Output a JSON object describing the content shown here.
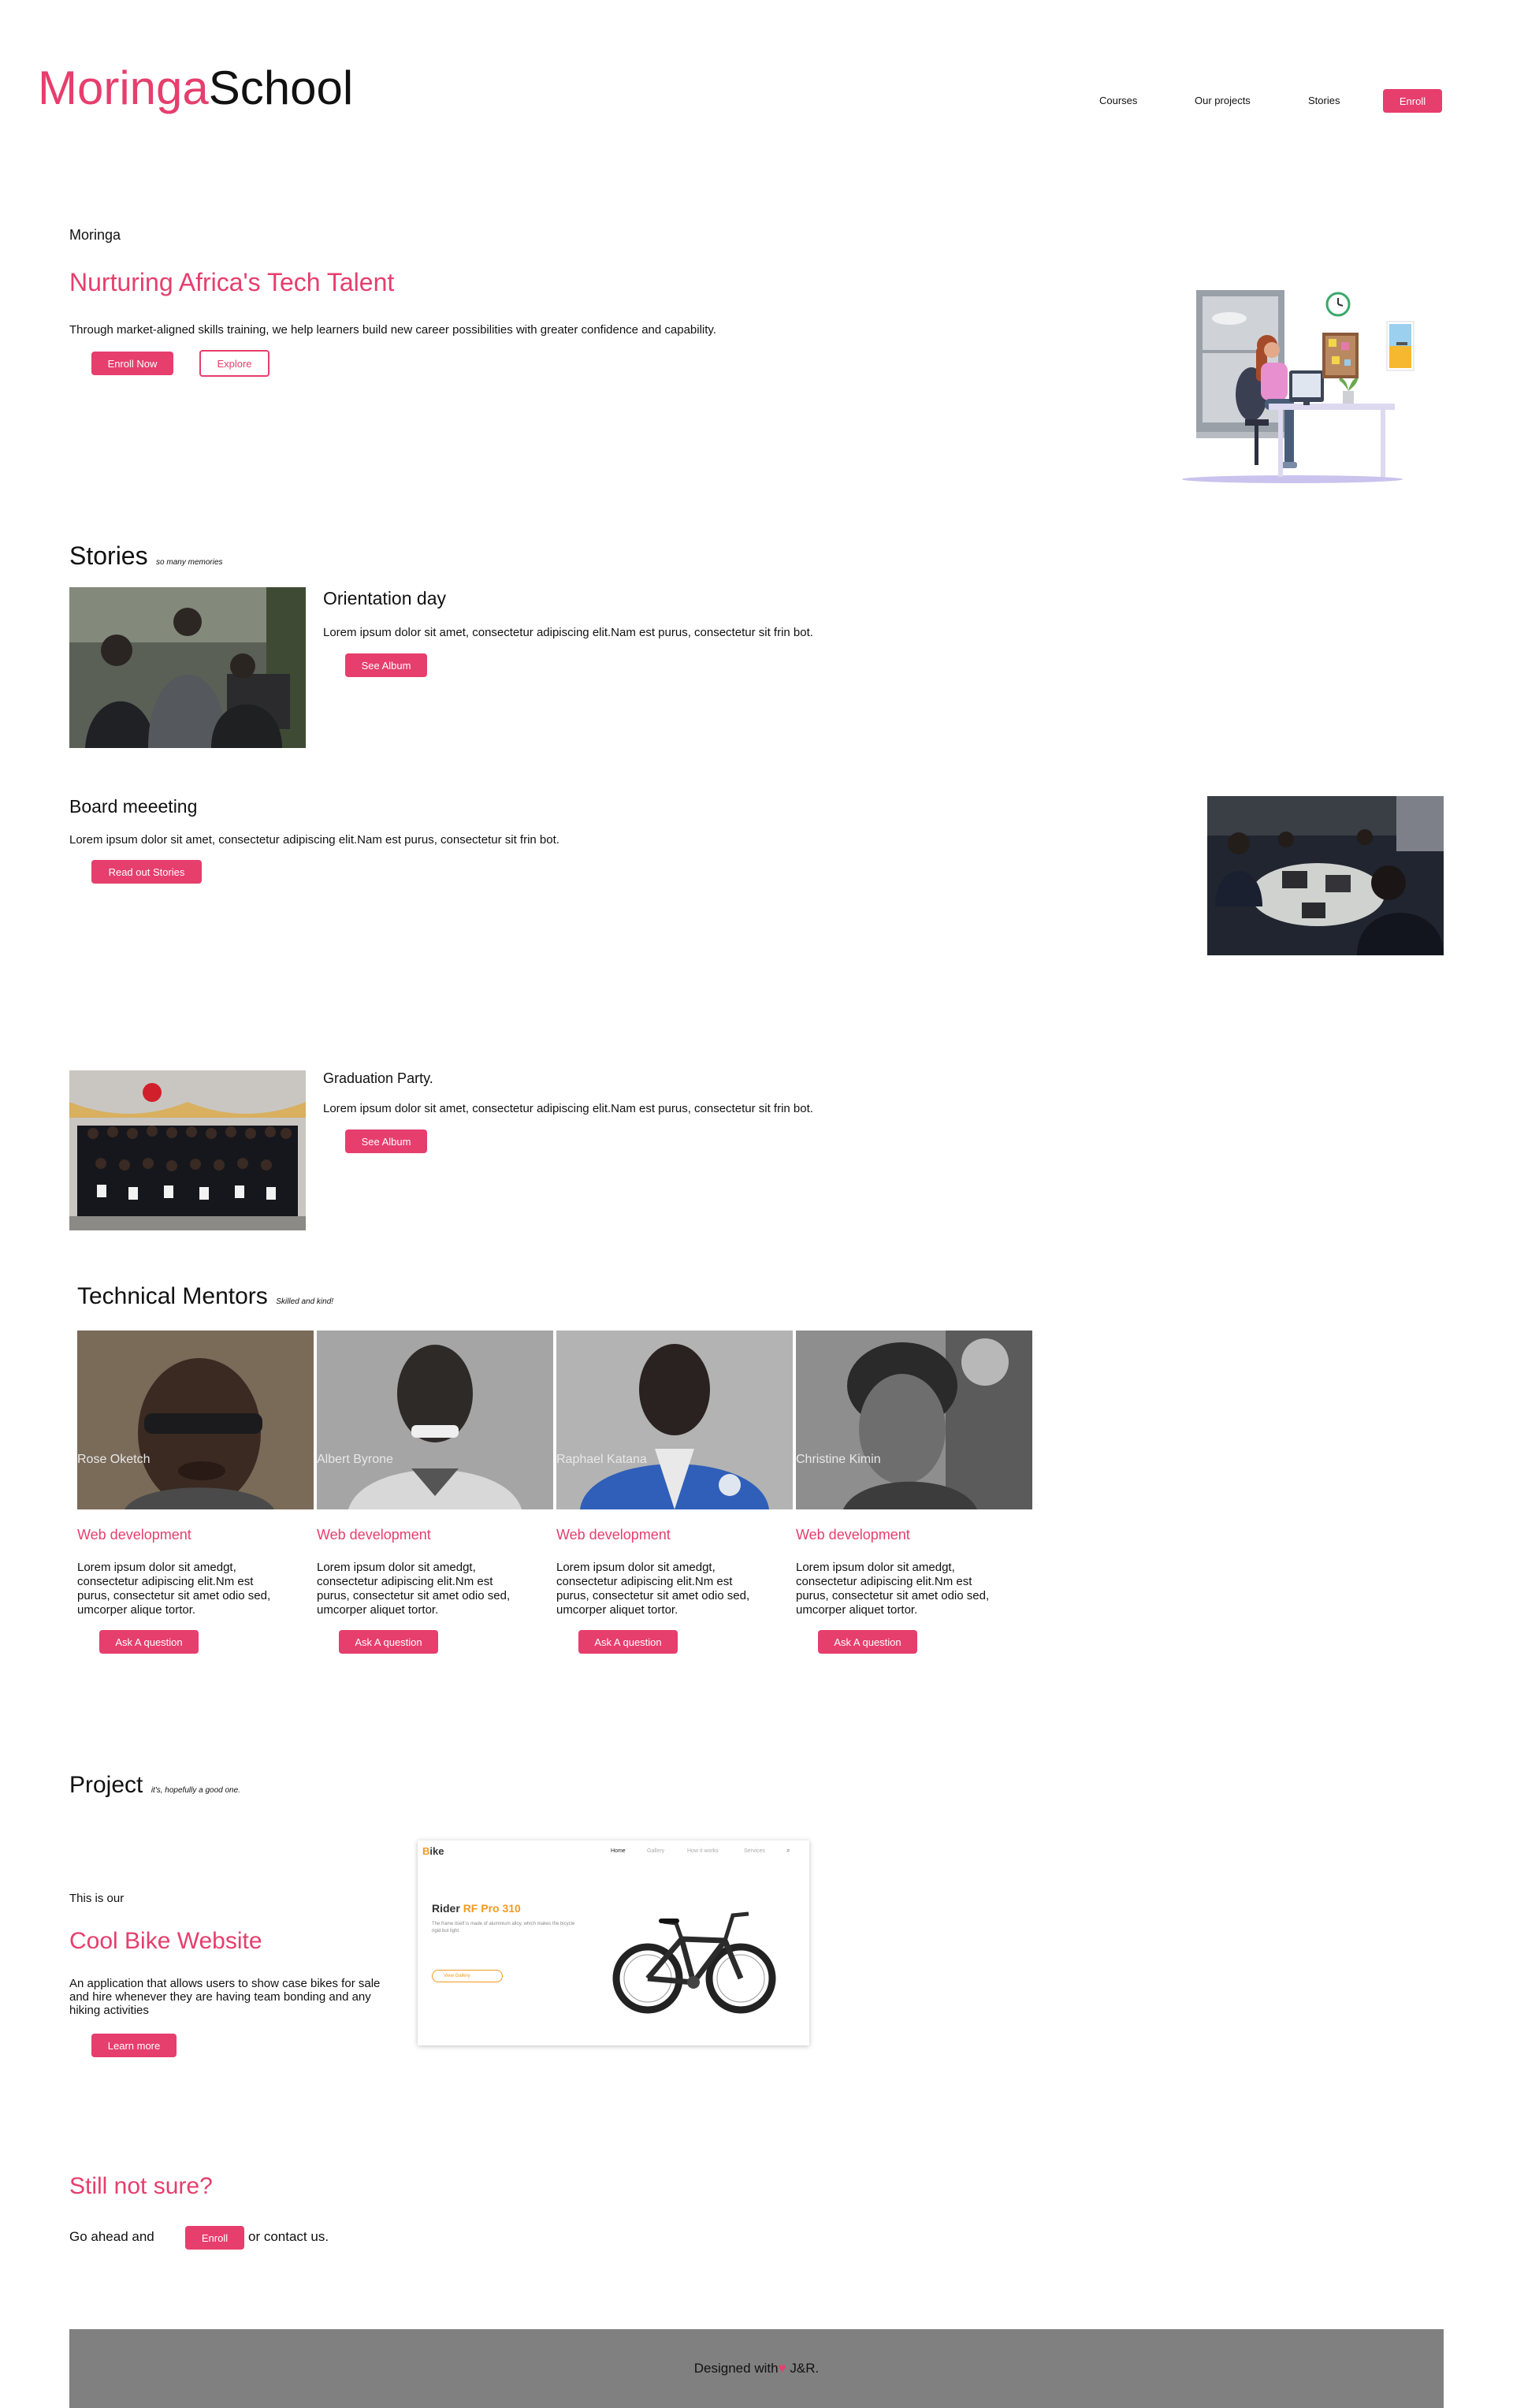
{
  "header": {
    "logo_part1": "Moringa",
    "logo_part2": "School",
    "nav": [
      "Courses",
      "Our projects",
      "Stories"
    ],
    "enroll_label": "Enroll"
  },
  "hero": {
    "eyebrow": "Moringa",
    "title": "Nurturing Africa's Tech Talent",
    "description": "Through market-aligned skills training, we help learners build new career possibilities with greater confidence and capability.",
    "enroll_now_label": "Enroll Now",
    "explore_label": "Explore"
  },
  "stories": {
    "heading": "Stories",
    "subheading": "so many memories",
    "items": [
      {
        "title": "Orientation day",
        "text": "Lorem ipsum dolor sit amet, consectetur adipiscing elit.Nam est purus, consectetur sit frin bot.",
        "button": "See Album"
      },
      {
        "title": "Board meeeting",
        "text": "Lorem ipsum dolor sit amet, consectetur adipiscing elit.Nam est purus, consectetur sit frin bot.",
        "button": "Read out Stories"
      },
      {
        "title": "Graduation Party.",
        "text": "Lorem ipsum dolor sit amet, consectetur adipiscing elit.Nam est purus, consectetur sit frin bot.",
        "button": "See Album"
      }
    ]
  },
  "mentors": {
    "heading": "Technical Mentors",
    "subheading": "Skilled and kind!",
    "items": [
      {
        "name": "Rose Oketch",
        "role": "Web development",
        "text": "Lorem ipsum dolor sit amedgt, consectetur adipiscing elit.Nm est purus, consectetur sit amet odio sed, umcorper alique tortor.",
        "button": "Ask A question"
      },
      {
        "name": "Albert Byrone",
        "role": "Web development",
        "text": "Lorem ipsum dolor sit amedgt, consectetur adipiscing elit.Nm est purus, consectetur sit amet odio sed, umcorper aliquet tortor.",
        "button": "Ask A question"
      },
      {
        "name": "Raphael Katana",
        "role": "Web development",
        "text": "Lorem ipsum dolor sit amedgt, consectetur adipiscing elit.Nm est purus, consectetur sit amet odio sed, umcorper aliquet tortor.",
        "button": "Ask A question"
      },
      {
        "name": "Christine Kimin",
        "role": "Web development",
        "text": "Lorem ipsum dolor sit amedgt, consectetur adipiscing elit.Nm est purus, consectetur sit amet odio sed, umcorper aliquet tortor.",
        "button": "Ask A question"
      }
    ]
  },
  "project": {
    "heading": "Project",
    "subheading": "it's, hopefully a good one.",
    "intro": "This is our",
    "title": "Cool Bike Website",
    "description": "An application that allows users to show case bikes for sale and hire whenever they are having team bonding and any hiking activities",
    "button": "Learn more",
    "preview": {
      "logo_first": "B",
      "logo_rest": "ike",
      "nav": [
        "Home",
        "Gallery",
        "How it works",
        "Services"
      ],
      "headline_part1": "Rider ",
      "headline_part2": "RF Pro 310",
      "blurb": "The frame itself is made of aluminium alloy, which makes the bicycle rigid but light.",
      "cta": "View Gallery"
    }
  },
  "cta": {
    "heading": "Still not sure?",
    "before": "Go ahead and",
    "button": "Enroll",
    "after": "or contact us."
  },
  "footer": {
    "text_before": "Designed with",
    "text_after": "J&R."
  },
  "colors": {
    "accent": "#e63e6d",
    "footer_bg": "#808080"
  }
}
